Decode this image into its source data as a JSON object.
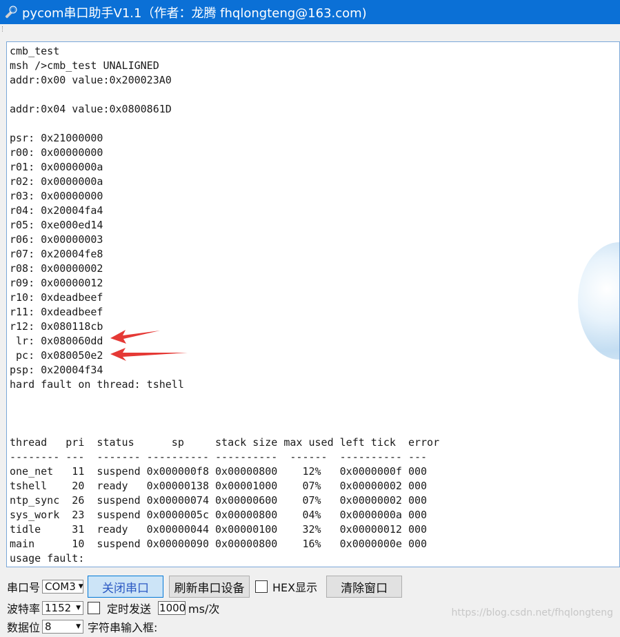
{
  "window": {
    "title": "pycom串口助手V1.1（作者：龙腾 fhqlongteng@163.com)"
  },
  "terminal": {
    "lines": [
      "cmb_test",
      "msh />cmb_test UNALIGNED",
      "addr:0x00 value:0x200023A0",
      "",
      "addr:0x04 value:0x0800861D",
      "",
      "psr: 0x21000000",
      "r00: 0x00000000",
      "r01: 0x0000000a",
      "r02: 0x0000000a",
      "r03: 0x00000000",
      "r04: 0x20004fa4",
      "r05: 0xe000ed14",
      "r06: 0x00000003",
      "r07: 0x20004fe8",
      "r08: 0x00000002",
      "r09: 0x00000012",
      "r10: 0xdeadbeef",
      "r11: 0xdeadbeef",
      "r12: 0x080118cb",
      " lr: 0x080060dd",
      " pc: 0x080050e2",
      "psp: 0x20004f34",
      "hard fault on thread: tshell",
      "",
      "",
      "",
      "thread   pri  status      sp     stack size max used left tick  error",
      "-------- ---  ------- ---------- ----------  ------  ---------- ---",
      "one_net   11  suspend 0x000000f8 0x00000800    12%   0x0000000f 000",
      "tshell    20  ready   0x00000138 0x00001000    07%   0x00000002 000",
      "ntp_sync  26  suspend 0x00000074 0x00000600    07%   0x00000002 000",
      "sys_work  23  suspend 0x0000005c 0x00000800    04%   0x0000000a 000",
      "tidle     31  ready   0x00000044 0x00000100    32%   0x00000012 000",
      "main      10  suspend 0x00000090 0x00000800    16%   0x0000000e 000",
      "usage fault:"
    ]
  },
  "controls": {
    "port_label": "串口号",
    "port_value": "COM3",
    "close_port_label": "关闭串口",
    "refresh_label": "刷新串口设备",
    "hex_display_label": "HEX显示",
    "clear_label": "清除窗口",
    "baud_label": "波特率",
    "baud_value": "1152",
    "timed_send_label": "定时发送",
    "interval_value": "1000",
    "interval_unit": "ms/次",
    "databits_label": "数据位",
    "databits_value": "8",
    "input_label": "字符串输入框:"
  },
  "watermark": "https://blog.csdn.net/fhqlongteng",
  "colors": {
    "titlebar": "#0b70d6",
    "annotation_arrow": "#e53935",
    "active_button": "#cce4f7"
  },
  "icons": {
    "app": "wrench-icon"
  }
}
